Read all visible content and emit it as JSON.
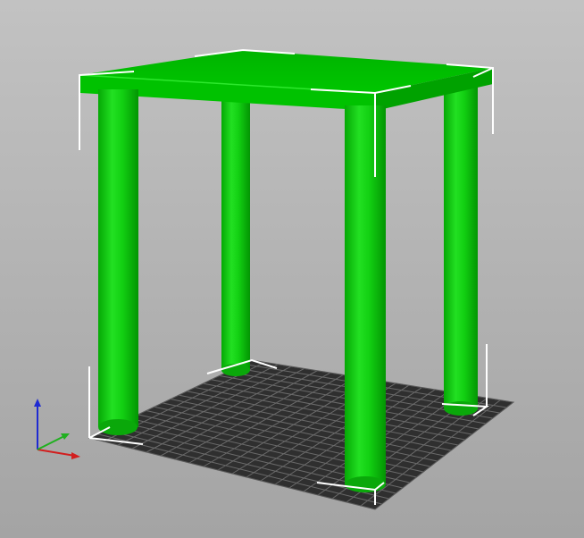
{
  "app": {
    "view": "3d-preview",
    "background_top": "#c2c2c2",
    "background_bottom": "#a4a4a4"
  },
  "model": {
    "name": "",
    "shape": "table",
    "leg_count": 4,
    "color": "#00c800",
    "color_dark": "#009f00",
    "color_light": "#3ce63c",
    "selected": true,
    "selection_bracket_color": "#ffffff"
  },
  "bed": {
    "grid_color": "#6a6a6a",
    "fill_color": "#2f2f2f"
  },
  "axes": {
    "x_color": "#d21e1e",
    "y_color": "#1fb01f",
    "z_color": "#1e2ad2"
  }
}
